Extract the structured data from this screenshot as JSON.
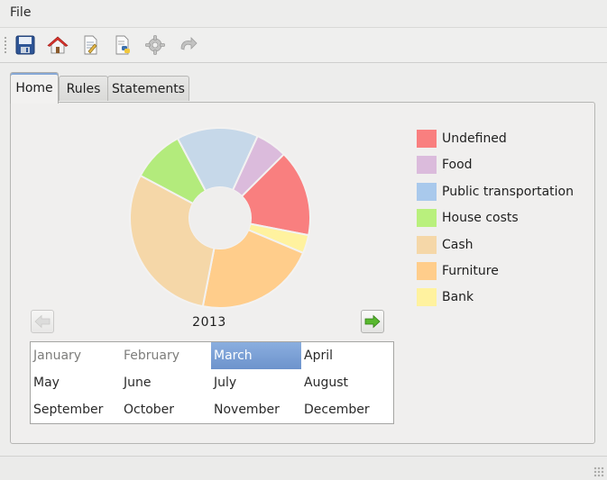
{
  "menubar": {
    "file_label": "File"
  },
  "toolbar": {
    "items": [
      {
        "icon": "save-icon"
      },
      {
        "icon": "home-icon"
      },
      {
        "icon": "document-edit-icon"
      },
      {
        "icon": "python-script-icon"
      },
      {
        "icon": "settings-icon"
      },
      {
        "icon": "redo-icon"
      }
    ]
  },
  "tabs": [
    {
      "label": "Home"
    },
    {
      "label": "Rules"
    },
    {
      "label": "Statements"
    }
  ],
  "chart_data": {
    "type": "pie",
    "categories": [
      "Undefined",
      "Bank",
      "Furniture",
      "Cash",
      "House costs",
      "Public transportation",
      "Food"
    ],
    "values": [
      16.5,
      3.5,
      23,
      31.5,
      10,
      15.5,
      6
    ],
    "colors": [
      "#f97f7f",
      "#fff29f",
      "#ffcd8b",
      "#f5d7a8",
      "#b3eb7c",
      "#c6d8e9",
      "#dbbbdc"
    ],
    "donut": true,
    "legend_placement": "right"
  },
  "legend": {
    "items": [
      {
        "label": "Undefined",
        "color": "#f97f7f"
      },
      {
        "label": "Food",
        "color": "#dbbbdc"
      },
      {
        "label": "Public transportation",
        "color": "#a9c9ec"
      },
      {
        "label": "House costs",
        "color": "#b9f07d"
      },
      {
        "label": "Cash",
        "color": "#f5d7a8"
      },
      {
        "label": "Furniture",
        "color": "#ffcd8b"
      },
      {
        "label": "Bank",
        "color": "#fff29f"
      }
    ]
  },
  "year_nav": {
    "year": "2013",
    "prev_icon": "arrow-left-icon",
    "next_icon": "arrow-right-icon",
    "prev_enabled": false,
    "next_enabled": true
  },
  "months": [
    {
      "label": "January",
      "state": "dim"
    },
    {
      "label": "February",
      "state": "dim"
    },
    {
      "label": "March",
      "state": "selected"
    },
    {
      "label": "April",
      "state": "normal"
    },
    {
      "label": "May",
      "state": "normal"
    },
    {
      "label": "June",
      "state": "normal"
    },
    {
      "label": "July",
      "state": "normal"
    },
    {
      "label": "August",
      "state": "normal"
    },
    {
      "label": "September",
      "state": "normal"
    },
    {
      "label": "October",
      "state": "normal"
    },
    {
      "label": "November",
      "state": "normal"
    },
    {
      "label": "December",
      "state": "normal"
    }
  ]
}
